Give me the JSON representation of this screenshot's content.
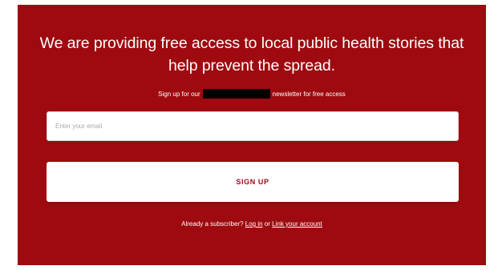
{
  "colors": {
    "panel_background": "#9e0a0f",
    "text": "#ffffff",
    "button_background": "#ffffff",
    "button_text": "#9e0a0f",
    "redaction": "#000000"
  },
  "promo": {
    "headline": "We are providing free access to local public health stories that help prevent the spread.",
    "sub_before": "Sign up for our",
    "sub_after": "newsletter for free access"
  },
  "form": {
    "email_placeholder": "Enter your email",
    "email_value": "",
    "signup_label": "SIGN UP"
  },
  "footer": {
    "prefix": "Already a subscriber?",
    "login_link": "Log in",
    "separator": "or",
    "link_account": "Link your account"
  }
}
